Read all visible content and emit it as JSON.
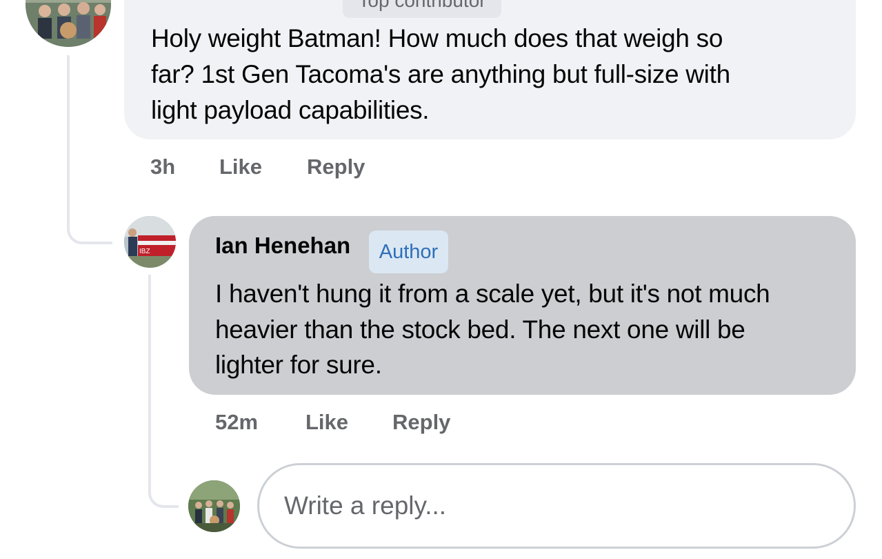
{
  "comment1": {
    "badge": "Top contributor",
    "text_lines": [
      "Holy weight Batman! How much does that weigh so",
      "far? 1st Gen Tacoma's are anything but full-size with",
      "light payload capabilities."
    ],
    "time": "3h",
    "like_label": "Like",
    "reply_label": "Reply"
  },
  "comment2": {
    "author": "Ian Henehan",
    "badge": "Author",
    "text_lines": [
      "I haven't hung it from a scale yet, but it's not much",
      "heavier than the stock bed. The next one will be",
      "lighter for sure."
    ],
    "time": "52m",
    "like_label": "Like",
    "reply_label": "Reply"
  },
  "reply_box": {
    "placeholder": "Write a reply..."
  }
}
